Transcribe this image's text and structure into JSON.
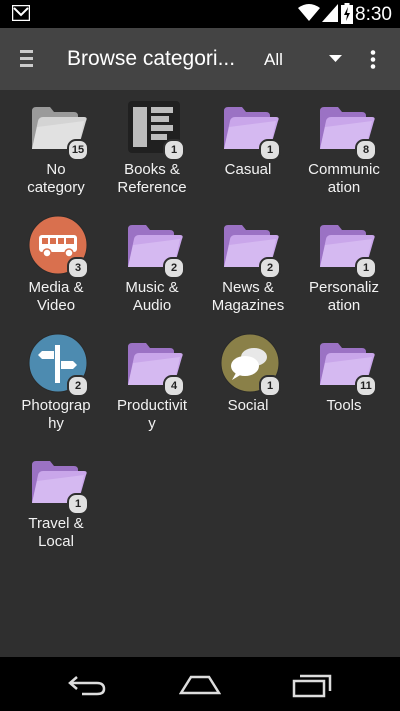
{
  "status_bar": {
    "time": "8:30"
  },
  "app_bar": {
    "title": "Browse categori...",
    "filter_value": "All"
  },
  "categories": [
    {
      "l1": "No",
      "l2": "category",
      "count": "15",
      "icon": "folder-gray-icon"
    },
    {
      "l1": "Books &",
      "l2": "Reference",
      "count": "1",
      "icon": "books-reference-icon"
    },
    {
      "l1": "Casual",
      "l2": "",
      "count": "1",
      "icon": "folder-purple-icon"
    },
    {
      "l1": "Communic",
      "l2": "ation",
      "count": "8",
      "icon": "folder-purple-icon"
    },
    {
      "l1": "Media &",
      "l2": "Video",
      "count": "3",
      "icon": "bus-icon"
    },
    {
      "l1": "Music &",
      "l2": "Audio",
      "count": "2",
      "icon": "folder-purple-icon"
    },
    {
      "l1": "News &",
      "l2": "Magazines",
      "count": "2",
      "icon": "folder-purple-icon"
    },
    {
      "l1": "Personaliz",
      "l2": "ation",
      "count": "1",
      "icon": "folder-purple-icon"
    },
    {
      "l1": "Photograp",
      "l2": "hy",
      "count": "2",
      "icon": "signpost-icon"
    },
    {
      "l1": "Productivit",
      "l2": "y",
      "count": "4",
      "icon": "folder-purple-icon"
    },
    {
      "l1": "Social",
      "l2": "",
      "count": "1",
      "icon": "chat-bubbles-icon"
    },
    {
      "l1": "Tools",
      "l2": "",
      "count": "11",
      "icon": "folder-purple-icon"
    },
    {
      "l1": "Travel &",
      "l2": "Local",
      "count": "1",
      "icon": "folder-purple-icon"
    }
  ],
  "colors": {
    "folder_purple": "#c9a6ea",
    "folder_gray": "#d4d4d4",
    "bus_circle": "#d9704e",
    "signpost_circle": "#4d8bb0",
    "chat_circle": "#8a8048"
  }
}
